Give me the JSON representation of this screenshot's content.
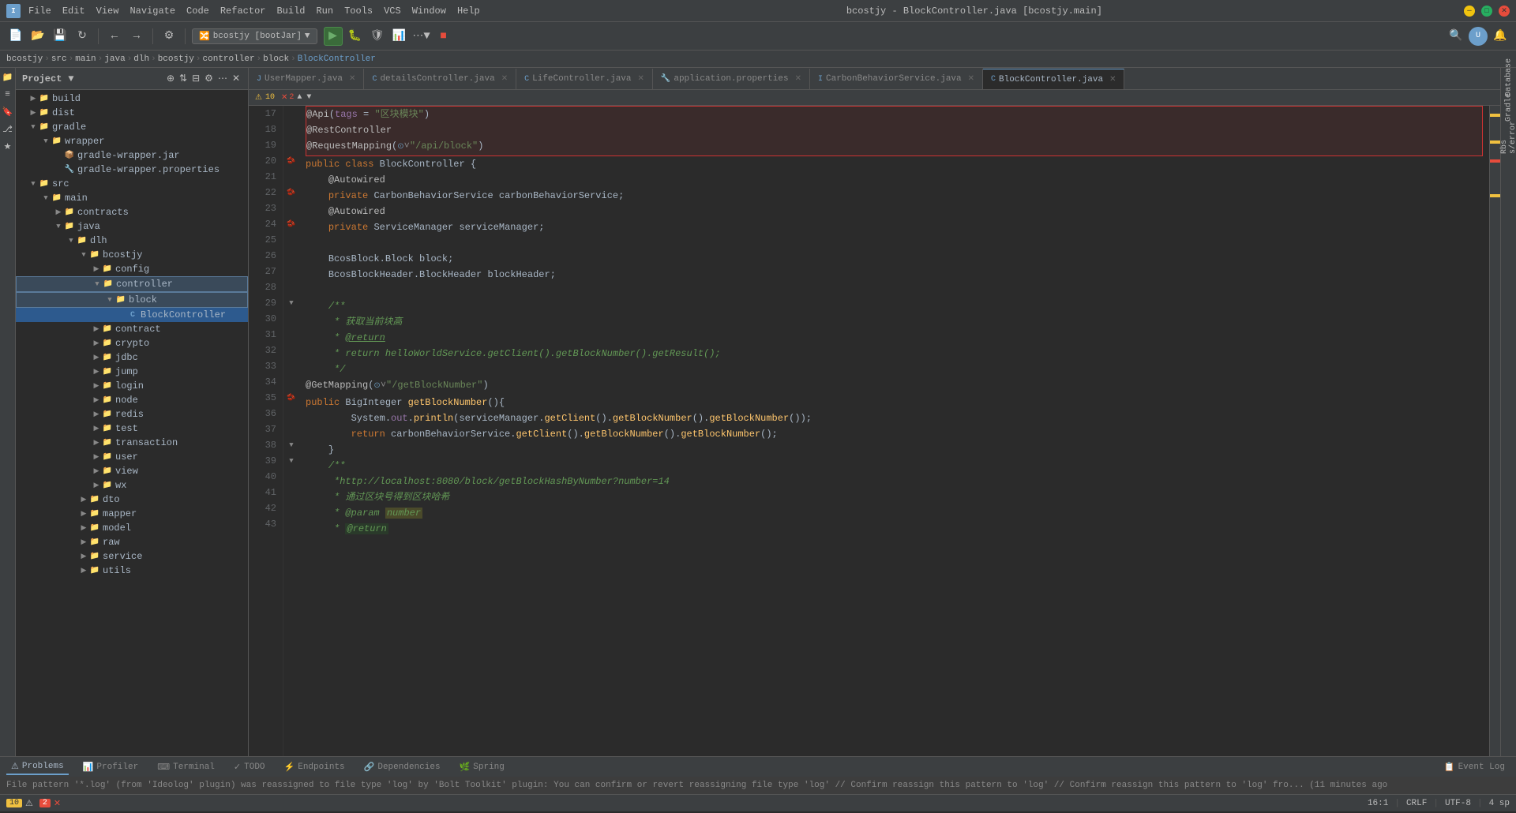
{
  "titleBar": {
    "title": "bcostjy - BlockController.java [bcostjy.main]",
    "menuItems": [
      "File",
      "Edit",
      "View",
      "Navigate",
      "Code",
      "Refactor",
      "Build",
      "Run",
      "Tools",
      "VCS",
      "Window",
      "Help"
    ]
  },
  "toolbar": {
    "branch": "bcostjy [bootJar]",
    "runConfig": "bcostjy [bootJar]"
  },
  "breadcrumb": {
    "parts": [
      "bcostjy",
      "src",
      "main",
      "java",
      "dlh",
      "bcostjy",
      "controller",
      "block",
      "BlockController"
    ]
  },
  "projectPanel": {
    "title": "Project",
    "tree": [
      {
        "id": "build",
        "label": "build",
        "level": 1,
        "type": "folder",
        "open": false
      },
      {
        "id": "dist",
        "label": "dist",
        "level": 1,
        "type": "folder",
        "open": false
      },
      {
        "id": "gradle",
        "label": "gradle",
        "level": 1,
        "type": "folder",
        "open": true
      },
      {
        "id": "wrapper",
        "label": "wrapper",
        "level": 2,
        "type": "folder",
        "open": true
      },
      {
        "id": "gradle-wrapper.jar",
        "label": "gradle-wrapper.jar",
        "level": 3,
        "type": "jar"
      },
      {
        "id": "gradle-wrapper.properties",
        "label": "gradle-wrapper.properties",
        "level": 3,
        "type": "prop"
      },
      {
        "id": "src",
        "label": "src",
        "level": 1,
        "type": "folder",
        "open": true
      },
      {
        "id": "main",
        "label": "main",
        "level": 2,
        "type": "folder",
        "open": true
      },
      {
        "id": "contracts",
        "label": "contracts",
        "level": 3,
        "type": "folder",
        "open": false
      },
      {
        "id": "java",
        "label": "java",
        "level": 3,
        "type": "folder",
        "open": true
      },
      {
        "id": "dlh",
        "label": "dlh",
        "level": 4,
        "type": "folder",
        "open": true
      },
      {
        "id": "bcostjy",
        "label": "bcostjy",
        "level": 5,
        "type": "folder",
        "open": true
      },
      {
        "id": "config",
        "label": "config",
        "level": 6,
        "type": "folder",
        "open": false
      },
      {
        "id": "controller",
        "label": "controller",
        "level": 6,
        "type": "folder",
        "open": true,
        "highlighted": true
      },
      {
        "id": "block",
        "label": "block",
        "level": 7,
        "type": "folder",
        "open": true,
        "highlighted": true
      },
      {
        "id": "BlockController",
        "label": "BlockController",
        "level": 8,
        "type": "java",
        "selected": true
      },
      {
        "id": "contract",
        "label": "contract",
        "level": 6,
        "type": "folder",
        "open": false
      },
      {
        "id": "crypto",
        "label": "crypto",
        "level": 6,
        "type": "folder",
        "open": false
      },
      {
        "id": "jdbc",
        "label": "jdbc",
        "level": 6,
        "type": "folder",
        "open": false
      },
      {
        "id": "jump",
        "label": "jump",
        "level": 6,
        "type": "folder",
        "open": false
      },
      {
        "id": "login",
        "label": "login",
        "level": 6,
        "type": "folder",
        "open": false
      },
      {
        "id": "node",
        "label": "node",
        "level": 6,
        "type": "folder",
        "open": false
      },
      {
        "id": "redis",
        "label": "redis",
        "level": 6,
        "type": "folder",
        "open": false
      },
      {
        "id": "test",
        "label": "test",
        "level": 6,
        "type": "folder",
        "open": false
      },
      {
        "id": "transaction",
        "label": "transaction",
        "level": 6,
        "type": "folder",
        "open": false
      },
      {
        "id": "user",
        "label": "user",
        "level": 6,
        "type": "folder",
        "open": false
      },
      {
        "id": "view",
        "label": "view",
        "level": 6,
        "type": "folder",
        "open": false
      },
      {
        "id": "wx",
        "label": "wx",
        "level": 6,
        "type": "folder",
        "open": false
      },
      {
        "id": "dto",
        "label": "dto",
        "level": 5,
        "type": "folder",
        "open": false
      },
      {
        "id": "mapper",
        "label": "mapper",
        "level": 5,
        "type": "folder",
        "open": false
      },
      {
        "id": "model",
        "label": "model",
        "level": 5,
        "type": "folder",
        "open": false
      },
      {
        "id": "raw",
        "label": "raw",
        "level": 5,
        "type": "folder",
        "open": false
      },
      {
        "id": "service",
        "label": "service",
        "level": 5,
        "type": "folder",
        "open": false
      },
      {
        "id": "utils",
        "label": "utils",
        "level": 5,
        "type": "folder",
        "open": false
      }
    ]
  },
  "tabs": [
    {
      "label": "UserMapper.java",
      "type": "java",
      "active": false
    },
    {
      "label": "detailsController.java",
      "type": "java",
      "active": false
    },
    {
      "label": "LifeController.java",
      "type": "java",
      "active": false
    },
    {
      "label": "application.properties",
      "type": "prop",
      "active": false
    },
    {
      "label": "CarbonBehaviorService.java",
      "type": "java",
      "active": false
    },
    {
      "label": "BlockController.java",
      "type": "java",
      "active": true
    }
  ],
  "code": {
    "startLine": 17,
    "lines": [
      {
        "num": 17,
        "content": "@Api(tags = \"区块模块\")",
        "highlighted": true
      },
      {
        "num": 18,
        "content": "@RestController",
        "highlighted": true
      },
      {
        "num": 19,
        "content": "@RequestMapping(☉ˇ\"/api/block\")",
        "highlighted": true
      },
      {
        "num": 20,
        "content": "public class BlockController {",
        "gutter": "bean"
      },
      {
        "num": 21,
        "content": "    @Autowired",
        "gutter": ""
      },
      {
        "num": 22,
        "content": "    private CarbonBehaviorService carbonBehaviorService;",
        "gutter": "bean"
      },
      {
        "num": 23,
        "content": "    @Autowired",
        "gutter": ""
      },
      {
        "num": 24,
        "content": "    private ServiceManager serviceManager;",
        "gutter": "bean"
      },
      {
        "num": 25,
        "content": "",
        "gutter": ""
      },
      {
        "num": 26,
        "content": "    BcosBlock.Block block;",
        "gutter": ""
      },
      {
        "num": 27,
        "content": "    BcosBlockHeader.BlockHeader blockHeader;",
        "gutter": ""
      },
      {
        "num": 28,
        "content": "",
        "gutter": ""
      },
      {
        "num": 29,
        "content": "    /**",
        "gutter": "fold"
      },
      {
        "num": 30,
        "content": "     * 获取当前块高",
        "gutter": ""
      },
      {
        "num": 31,
        "content": "     * @return",
        "gutter": ""
      },
      {
        "num": 32,
        "content": "     * return helloWorldService.getClient().getBlockNumber().getResult();",
        "gutter": ""
      },
      {
        "num": 33,
        "content": "     */",
        "gutter": ""
      },
      {
        "num": 34,
        "content": "@GetMapping(☉ˇ\"/getBlockNumber\")",
        "gutter": ""
      },
      {
        "num": 35,
        "content": "public BigInteger getBlockNumber(){",
        "gutter": "bean"
      },
      {
        "num": 36,
        "content": "        System.out.println(serviceManager.getClient().getBlockNumber().getBlockNumber());",
        "gutter": ""
      },
      {
        "num": 37,
        "content": "        return carbonBehaviorService.getClient().getBlockNumber().getBlockNumber();",
        "gutter": ""
      },
      {
        "num": 38,
        "content": "    }",
        "gutter": "fold"
      },
      {
        "num": 39,
        "content": "    /**",
        "gutter": "fold"
      },
      {
        "num": 40,
        "content": "     *http://localhost:8080/block/getBlockHashByNumber?number=14",
        "gutter": ""
      },
      {
        "num": 41,
        "content": "     * 通过区块号得到区块哈希",
        "gutter": ""
      },
      {
        "num": 42,
        "content": "     * @param number",
        "gutter": ""
      },
      {
        "num": 43,
        "content": "     * @return",
        "gutter": ""
      }
    ]
  },
  "statusBar": {
    "warnings": "10",
    "errors": "2",
    "position": "16:1",
    "lineEnding": "CRLF",
    "encoding": "UTF-8",
    "indent": "4 sp"
  },
  "bottomTabs": {
    "items": [
      "Problems",
      "Profiler",
      "Terminal",
      "TODO",
      "Endpoints",
      "Dependencies",
      "Spring"
    ],
    "rightItems": [
      "Event Log"
    ],
    "activeItem": "Problems"
  },
  "infoBar": {
    "message": "File pattern '*.log' (from 'Ideolog' plugin) was reassigned to file type 'log' by 'Bolt Toolkit' plugin: You can confirm or revert reassigning file type 'log' // Confirm reassign this pattern to 'log' // Confirm reassign this pattern to 'log' fro... (11 minutes ago"
  },
  "rightPanelLabels": [
    "Database",
    "Gradle",
    "Rbs s/error"
  ]
}
